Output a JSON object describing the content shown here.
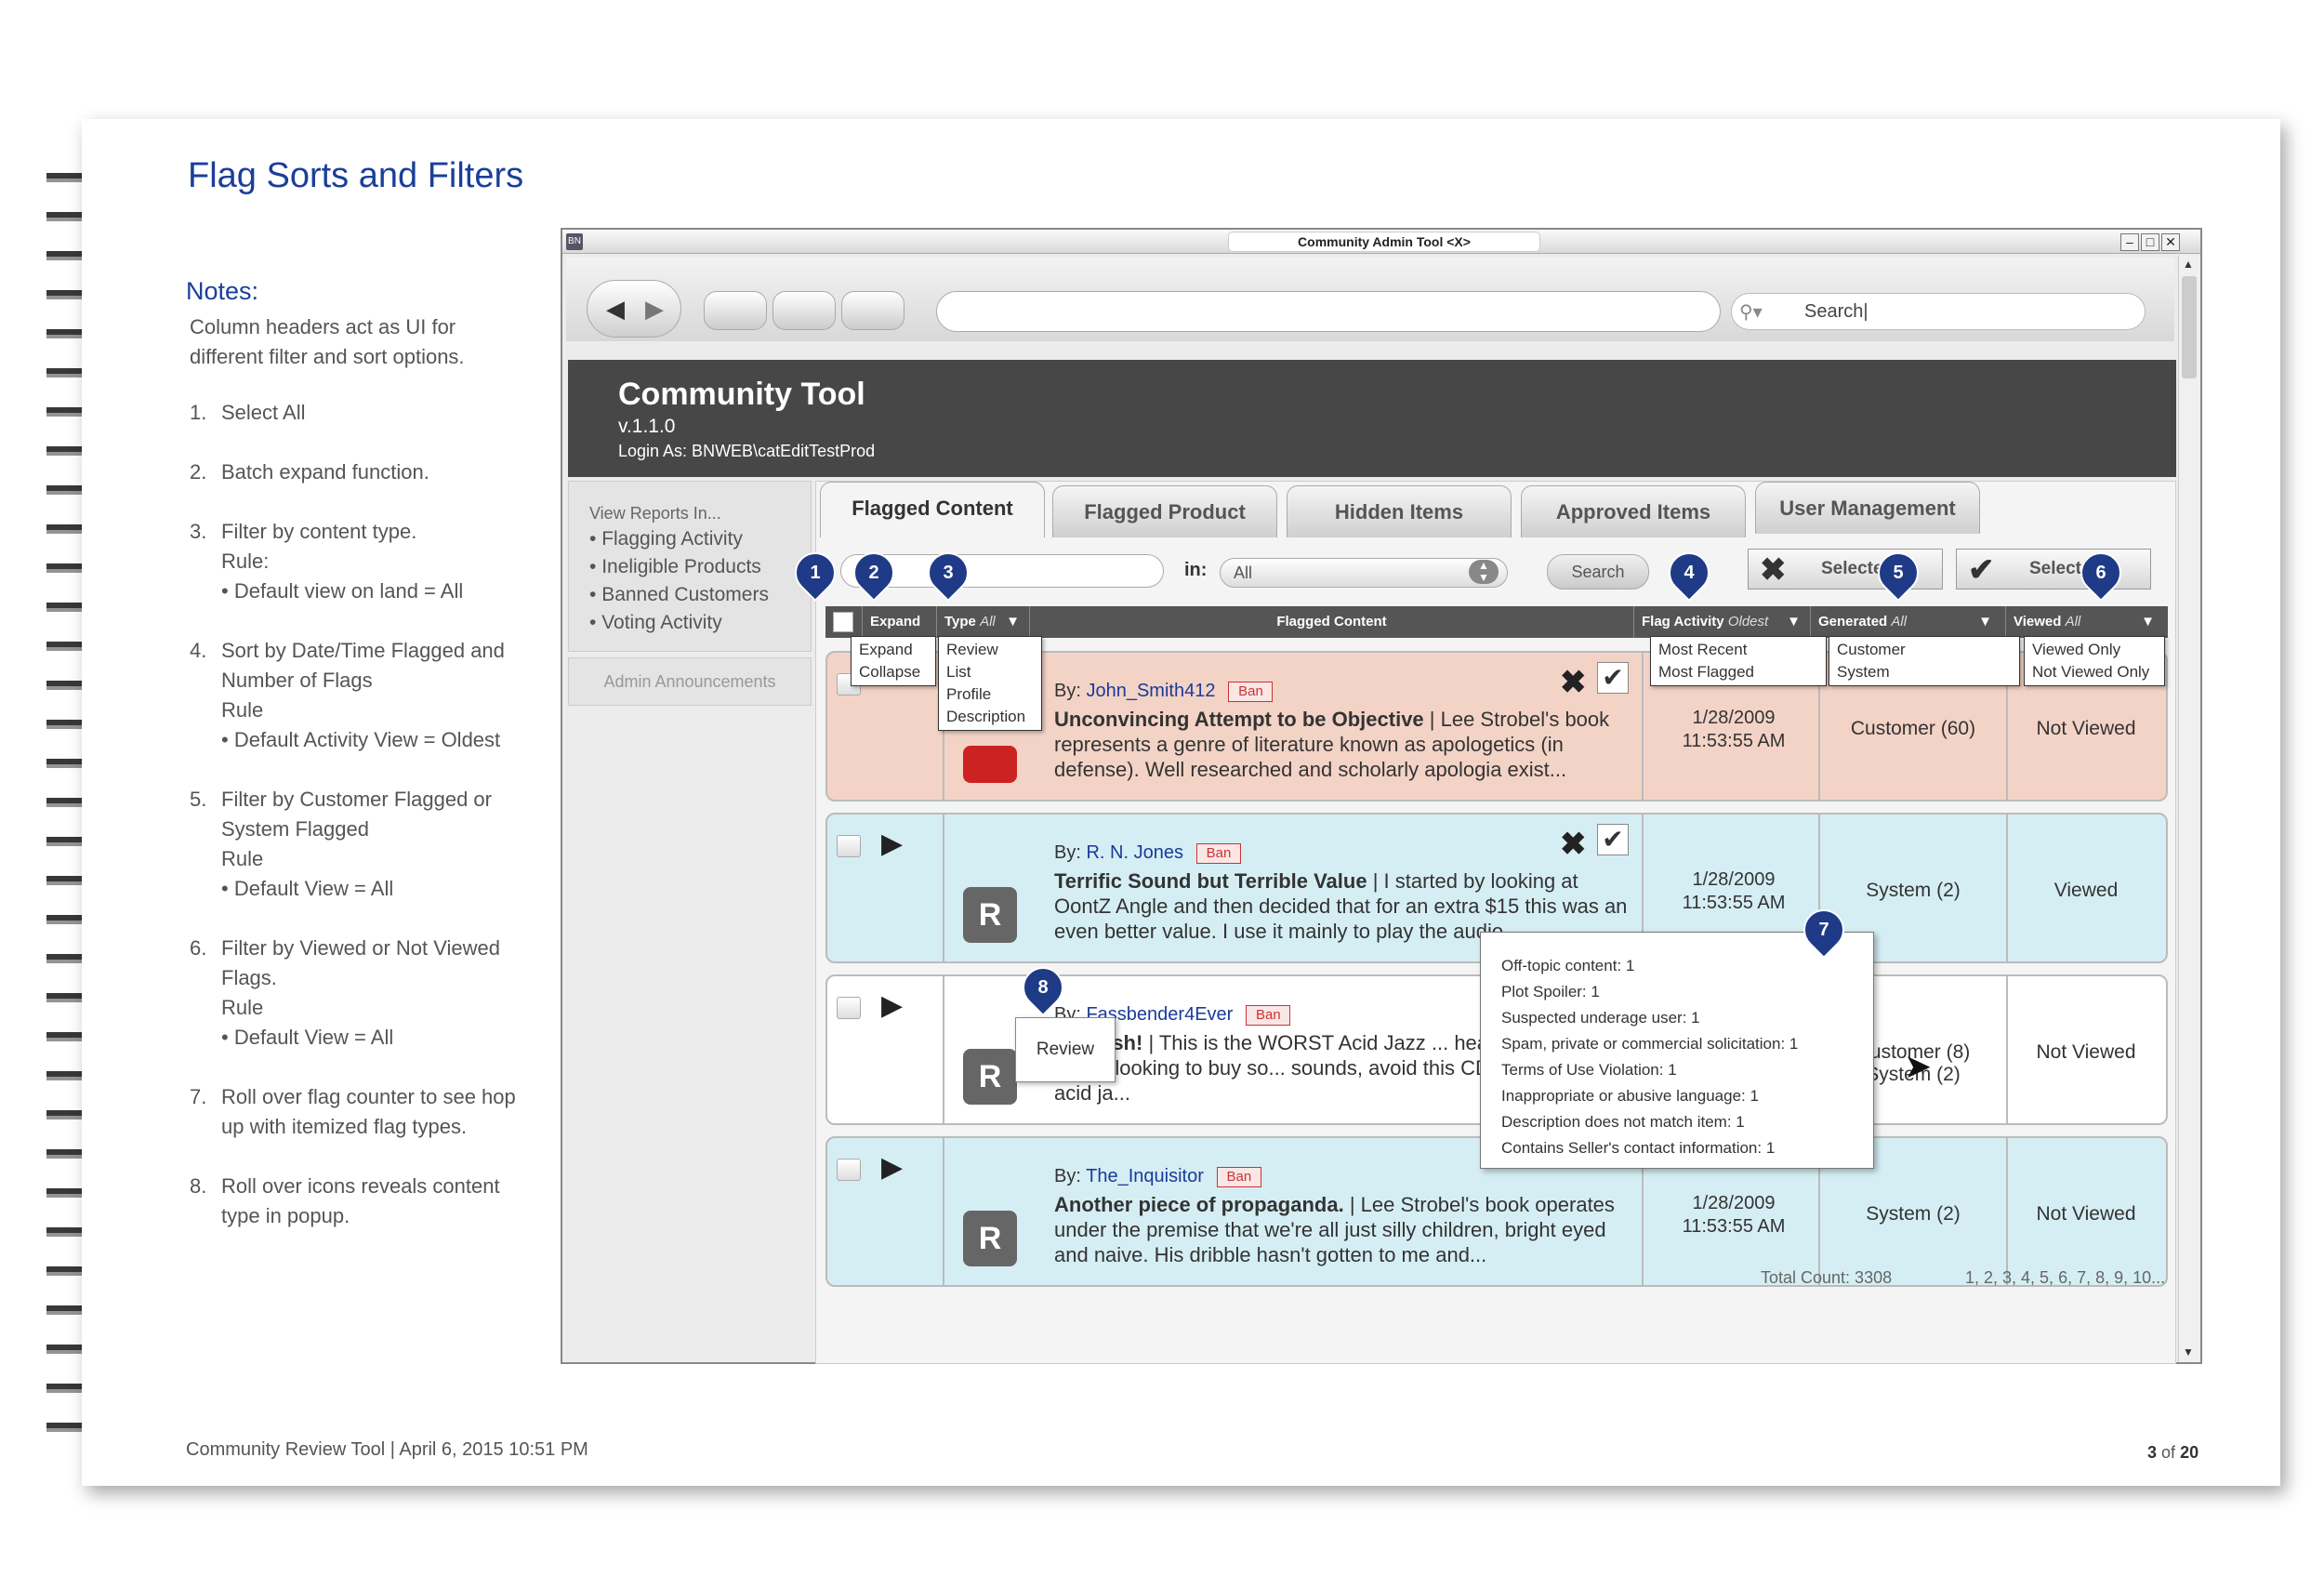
{
  "page": {
    "title": "Flag Sorts and Filters",
    "notes_heading": "Notes:",
    "intro": [
      "Column headers act as UI for",
      "different filter and sort options."
    ],
    "notes": [
      {
        "num": "1.",
        "lines": [
          "Select All"
        ]
      },
      {
        "num": "2.",
        "lines": [
          "Batch expand function."
        ]
      },
      {
        "num": "3.",
        "lines": [
          "Filter by content type.",
          "Rule:",
          "• Default view on land = All"
        ]
      },
      {
        "num": "4.",
        "lines": [
          "Sort by Date/Time Flagged and",
          "Number of Flags",
          "Rule",
          "• Default Activity View = Oldest"
        ]
      },
      {
        "num": "5.",
        "lines": [
          "Filter by Customer Flagged or",
          "System Flagged",
          "Rule",
          "• Default View = All"
        ]
      },
      {
        "num": "6.",
        "lines": [
          "Filter by Viewed or Not Viewed",
          "Flags.",
          "Rule",
          "• Default View = All"
        ]
      },
      {
        "num": "7.",
        "lines": [
          "Roll over flag counter to see hop",
          "up with itemized flag types."
        ]
      },
      {
        "num": "8.",
        "lines": [
          "Roll over icons reveals content",
          "type in popup."
        ]
      }
    ],
    "footer_left": "Community Review Tool | April 6, 2015 10:51 PM",
    "footer_page": "3",
    "footer_of": "of",
    "footer_total": "20"
  },
  "window": {
    "title": "Community Admin Tool <X>",
    "app_icon": "BN",
    "search_placeholder": "Search|",
    "min": "–",
    "max": "□",
    "close": "✕"
  },
  "app": {
    "title": "Community Tool",
    "version": "v.1.1.0",
    "login": "Login As: BNWEB\\catEditTestProd"
  },
  "leftnav": {
    "heading": "View Reports In...",
    "items": [
      "Flagging Activity",
      "Ineligible Products",
      "Banned Customers",
      "Voting Activity"
    ],
    "admin": "Admin Announcements"
  },
  "tabs": [
    "Flagged Content",
    "Flagged Product",
    "Hidden Items",
    "Approved Items",
    "User Management"
  ],
  "filter": {
    "in_label": "in:",
    "select_value": "All",
    "search_btn": "Search",
    "reject_selected": "Selected",
    "approve_selected": "Selected"
  },
  "columns": {
    "expand": "Expand",
    "type": "Type",
    "type_val": "All",
    "content": "Flagged Content",
    "activity": "Flag Activity",
    "activity_val": "Oldest",
    "generated": "Generated",
    "generated_val": "All",
    "viewed": "Viewed",
    "viewed_val": "All"
  },
  "dropdowns": {
    "expand": [
      "Expand",
      "Collapse"
    ],
    "type": [
      "Review",
      "List",
      "Profile",
      "Description"
    ],
    "activity": [
      "Most Recent",
      "Most Flagged"
    ],
    "generated": [
      "Customer",
      "System"
    ],
    "viewed": [
      "Viewed Only",
      "Not Viewed Only"
    ]
  },
  "rows": [
    {
      "by": "By:",
      "user": "John_Smith412",
      "ban": "Ban",
      "title": "Unconvincing Attempt to be Objective",
      "body": " | Lee Strobel's book represents a genre of literature known as apologetics (in defense). Well researched and scholarly apologia exist...",
      "date": "1/28/2009",
      "time": "11:53:55 AM",
      "generated": "Customer (60)",
      "viewed": "Not Viewed",
      "bg": "#f3d3c6",
      "icon": "R"
    },
    {
      "by": "By:",
      "user": "R. N. Jones",
      "ban": "Ban",
      "title": "Terrific Sound but Terrible Value",
      "body": " | I started by looking at OontZ Angle and then decided that for an extra $15 this was an even better value. I use it mainly to play the audio...",
      "date": "1/28/2009",
      "time": "11:53:55 AM",
      "generated": "System (2)",
      "viewed": "Viewed",
      "bg": "#d5eef4",
      "icon": "R"
    },
    {
      "by": "By:",
      "user": "Fassbender4Ever",
      "ban": "Ban",
      "title": "Rubbish!",
      "body": " | This is the WORST Acid Jazz ... heard. In fact, if you're looking to buy so... sounds, avoid this CD because it's not acid ja...",
      "date": "",
      "time": "",
      "generated": "Customer (8) System (2)",
      "viewed": "Not Viewed",
      "bg": "#ffffff",
      "icon": "R"
    },
    {
      "by": "By:",
      "user": "The_Inquisitor",
      "ban": "Ban",
      "title": "Another piece of propaganda.",
      "body": " | Lee Strobel's book operates under the premise that we're all just silly children, bright eyed and naive. His dribble hasn't gotten to me and...",
      "date": "1/28/2009",
      "time": "11:53:55 AM",
      "generated": "System (2)",
      "viewed": "Not Viewed",
      "bg": "#d5eef4",
      "icon": "R"
    }
  ],
  "tooltip": [
    "Off-topic content: 1",
    "Plot Spoiler: 1",
    "Suspected underage user: 1",
    "Spam, private or commercial solicitation: 1",
    "Terms of Use Violation: 1",
    "Inappropriate or abusive language: 1",
    "Description does not match item: 1",
    "Contains Seller's contact information: 1"
  ],
  "review_popup": "Review",
  "totals": {
    "count": "Total Count: 3308",
    "pages": "1, 2, 3, 4, 5, 6, 7, 8, 9, 10..."
  },
  "pins": [
    "1",
    "2",
    "3",
    "4",
    "5",
    "6",
    "7",
    "8"
  ]
}
